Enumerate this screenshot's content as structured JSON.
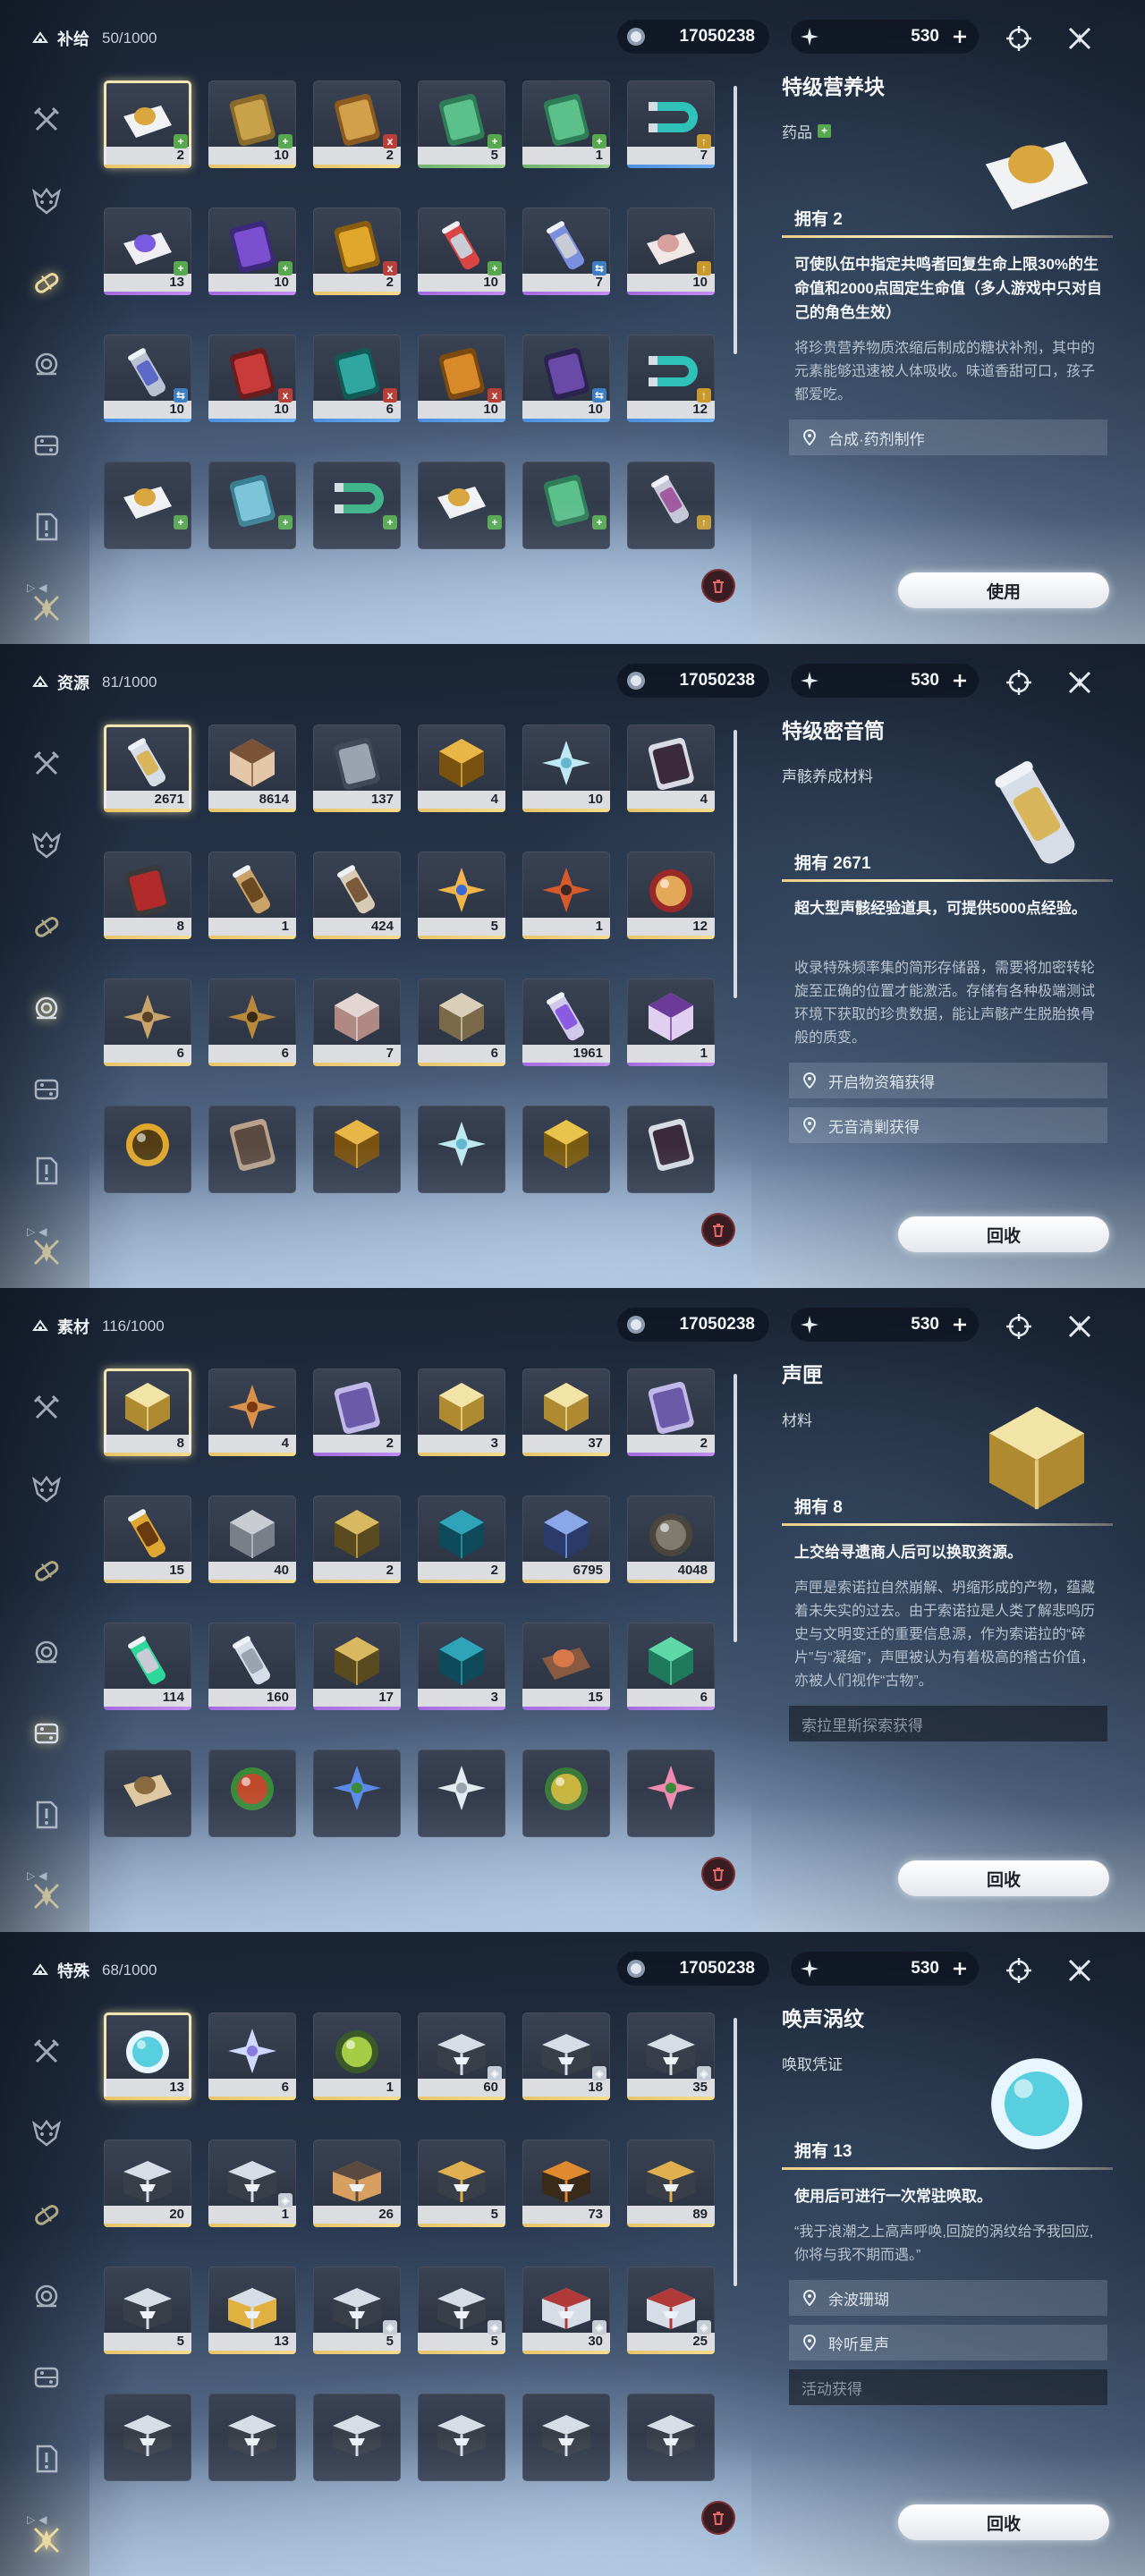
{
  "currency": {
    "coins": "17050238",
    "stamina": "530"
  },
  "panels": [
    {
      "category": "补给",
      "count": "50/1000",
      "active_sidebar": 2,
      "detail": {
        "name": "特级营养块",
        "type": "药品",
        "type_badge": "+",
        "owned": "拥有 2",
        "main": "可使队伍中指定共鸣者回复生命上限30%的生命值和2000点固定生命值（多人游戏中只对自己的角色生效）",
        "desc": "将珍贵营养物质浓缩后制成的糖状补剂，其中的元素能够迅速被人体吸收。味道香甜可口，孩子都爱吃。",
        "sources": [
          "合成·药剂制作"
        ],
        "button": "使用"
      },
      "items": [
        {
          "qty": "2",
          "rarity": "g5",
          "badge": "plus",
          "badge_text": "+",
          "art": "pouch-white"
        },
        {
          "qty": "10",
          "rarity": "g5",
          "badge": "plus",
          "badge_text": "+",
          "art": "bag-gold"
        },
        {
          "qty": "2",
          "rarity": "g5",
          "badge": "x",
          "badge_text": "x",
          "art": "crackers"
        },
        {
          "qty": "5",
          "rarity": "g2",
          "badge": "plus",
          "badge_text": "+",
          "art": "bag-green"
        },
        {
          "qty": "1",
          "rarity": "g2",
          "badge": "plus",
          "badge_text": "+",
          "art": "bag-green"
        },
        {
          "qty": "7",
          "rarity": "g3",
          "badge": "up",
          "badge_text": "↑",
          "art": "magnet"
        },
        {
          "qty": "13",
          "rarity": "g4",
          "badge": "plus",
          "badge_text": "+",
          "art": "pouch-purple"
        },
        {
          "qty": "10",
          "rarity": "g4",
          "badge": "plus",
          "badge_text": "+",
          "art": "bag-purple"
        },
        {
          "qty": "2",
          "rarity": "g5",
          "badge": "x",
          "badge_text": "x",
          "art": "pipe-gold"
        },
        {
          "qty": "10",
          "rarity": "g4",
          "badge": "plus",
          "badge_text": "+",
          "art": "vial-red"
        },
        {
          "qty": "7",
          "rarity": "g4",
          "badge": "swap",
          "badge_text": "⇆",
          "art": "vial-blue"
        },
        {
          "qty": "10",
          "rarity": "g4",
          "badge": "up",
          "badge_text": "↑",
          "art": "teapot"
        },
        {
          "qty": "10",
          "rarity": "g3",
          "badge": "swap",
          "badge_text": "⇆",
          "art": "can-blue"
        },
        {
          "qty": "10",
          "rarity": "g3",
          "badge": "x",
          "badge_text": "x",
          "art": "bag-red"
        },
        {
          "qty": "6",
          "rarity": "g3",
          "badge": "x",
          "badge_text": "x",
          "art": "bag-teal"
        },
        {
          "qty": "10",
          "rarity": "g3",
          "badge": "x",
          "badge_text": "x",
          "art": "bag-orange"
        },
        {
          "qty": "10",
          "rarity": "g3",
          "badge": "swap",
          "badge_text": "⇆",
          "art": "bag-purple2"
        },
        {
          "qty": "12",
          "rarity": "g3",
          "badge": "up",
          "badge_text": "↑",
          "art": "magnet"
        },
        {
          "qty": "",
          "rarity": "",
          "badge": "plus",
          "badge_text": "+",
          "art": "pouch-white"
        },
        {
          "qty": "",
          "rarity": "",
          "badge": "plus",
          "badge_text": "+",
          "art": "bag-teal2"
        },
        {
          "qty": "",
          "rarity": "",
          "badge": "plus",
          "badge_text": "+",
          "art": "magnet-green"
        },
        {
          "qty": "",
          "rarity": "",
          "badge": "plus",
          "badge_text": "+",
          "art": "pouch-white"
        },
        {
          "qty": "",
          "rarity": "",
          "badge": "plus",
          "badge_text": "+",
          "art": "bag-green"
        },
        {
          "qty": "",
          "rarity": "",
          "badge": "up",
          "badge_text": "↑",
          "art": "potion"
        }
      ]
    },
    {
      "category": "资源",
      "count": "81/1000",
      "active_sidebar": 3,
      "detail": {
        "name": "特级密音筒",
        "type": "声骸养成材料",
        "type_badge": "",
        "owned": "拥有 2671",
        "main": "超大型声骸经验道具，可提供5000点经验。",
        "desc": "收录特殊频率集的简形存储器，需要将加密转轮旋至正确的位置才能激活。存储有各种极端测试环境下获取的珍贵数据，能让声骸产生脱胎换骨般的质变。",
        "sources": [
          "开启物资箱获得",
          "无音清剿获得"
        ],
        "button": "回收"
      },
      "items": [
        {
          "qty": "2671",
          "rarity": "g5",
          "badge": "",
          "badge_text": "",
          "art": "cylinder"
        },
        {
          "qty": "8614",
          "rarity": "g5",
          "badge": "",
          "badge_text": "",
          "art": "d20"
        },
        {
          "qty": "137",
          "rarity": "g5",
          "badge": "",
          "badge_text": "",
          "art": "device"
        },
        {
          "qty": "4",
          "rarity": "g5",
          "badge": "",
          "badge_text": "",
          "art": "gold-hex"
        },
        {
          "qty": "10",
          "rarity": "g5",
          "badge": "",
          "badge_text": "",
          "art": "crystal-flower"
        },
        {
          "qty": "4",
          "rarity": "g5",
          "badge": "",
          "badge_text": "",
          "art": "mask"
        },
        {
          "qty": "8",
          "rarity": "g5",
          "badge": "",
          "badge_text": "",
          "art": "red-mech"
        },
        {
          "qty": "1",
          "rarity": "g5",
          "badge": "",
          "badge_text": "",
          "art": "scroll"
        },
        {
          "qty": "424",
          "rarity": "g5",
          "badge": "",
          "badge_text": "",
          "art": "bottle"
        },
        {
          "qty": "5",
          "rarity": "g5",
          "badge": "",
          "badge_text": "",
          "art": "flame-blue"
        },
        {
          "qty": "1",
          "rarity": "g5",
          "badge": "",
          "badge_text": "",
          "art": "flame-red"
        },
        {
          "qty": "12",
          "rarity": "g5",
          "badge": "",
          "badge_text": "",
          "art": "orb-red"
        },
        {
          "qty": "6",
          "rarity": "g5",
          "badge": "",
          "badge_text": "",
          "art": "feather"
        },
        {
          "qty": "6",
          "rarity": "g5",
          "badge": "",
          "badge_text": "",
          "art": "claw"
        },
        {
          "qty": "7",
          "rarity": "g5",
          "badge": "",
          "badge_text": "",
          "art": "cubes"
        },
        {
          "qty": "6",
          "rarity": "g5",
          "badge": "",
          "badge_text": "",
          "art": "web"
        },
        {
          "qty": "1961",
          "rarity": "g4",
          "badge": "",
          "badge_text": "",
          "art": "cylinder-purple"
        },
        {
          "qty": "1",
          "rarity": "g4",
          "badge": "",
          "badge_text": "",
          "art": "d20-purple"
        },
        {
          "qty": "",
          "rarity": "",
          "badge": "",
          "badge_text": "",
          "art": "orb-gold"
        },
        {
          "qty": "",
          "rarity": "",
          "badge": "",
          "badge_text": "",
          "art": "ring"
        },
        {
          "qty": "",
          "rarity": "",
          "badge": "",
          "badge_text": "",
          "art": "gold-hex"
        },
        {
          "qty": "",
          "rarity": "",
          "badge": "",
          "badge_text": "",
          "art": "crystal-flower"
        },
        {
          "qty": "",
          "rarity": "",
          "badge": "",
          "badge_text": "",
          "art": "triangle-gold"
        },
        {
          "qty": "",
          "rarity": "",
          "badge": "",
          "badge_text": "",
          "art": "mask"
        }
      ]
    },
    {
      "category": "素材",
      "count": "116/1000",
      "active_sidebar": 4,
      "detail": {
        "name": "声匣",
        "type": "材料",
        "type_badge": "",
        "owned": "拥有 8",
        "main": "上交给寻遗商人后可以换取资源。",
        "desc": "声匣是索诺拉自然崩解、坍缩形成的产物，蕴藏着未失实的过去。由于索诺拉是人类了解悲鸣历史与文明变迁的重要信息源，作为索诺拉的“碎片”与“凝缩”，声匣被认为有着极高的稽古价值，亦被人们视作“古物”。",
        "sources": [],
        "source_dark": "索拉里斯探索获得",
        "button": "回收"
      },
      "items": [
        {
          "qty": "8",
          "rarity": "g5",
          "badge": "",
          "badge_text": "",
          "art": "glow-cube"
        },
        {
          "qty": "4",
          "rarity": "g5",
          "badge": "",
          "badge_text": "",
          "art": "burst"
        },
        {
          "qty": "2",
          "rarity": "g4",
          "badge": "",
          "badge_text": "",
          "art": "card-purple"
        },
        {
          "qty": "3",
          "rarity": "g5",
          "badge": "",
          "badge_text": "",
          "art": "glow-cube"
        },
        {
          "qty": "37",
          "rarity": "g5",
          "badge": "",
          "badge_text": "",
          "art": "glow-cube"
        },
        {
          "qty": "2",
          "rarity": "g4",
          "badge": "",
          "badge_text": "",
          "art": "card-purple"
        },
        {
          "qty": "15",
          "rarity": "g5",
          "badge": "",
          "badge_text": "",
          "art": "jar-gold"
        },
        {
          "qty": "40",
          "rarity": "g5",
          "badge": "",
          "badge_text": "",
          "art": "cube-silver"
        },
        {
          "qty": "2",
          "rarity": "g5",
          "badge": "",
          "badge_text": "",
          "art": "octa-gold"
        },
        {
          "qty": "2",
          "rarity": "g5",
          "badge": "",
          "badge_text": "",
          "art": "crystal-teal"
        },
        {
          "qty": "6795",
          "rarity": "g5",
          "badge": "",
          "badge_text": "",
          "art": "shard-blue"
        },
        {
          "qty": "4048",
          "rarity": "g5",
          "badge": "",
          "badge_text": "",
          "art": "stone"
        },
        {
          "qty": "114",
          "rarity": "g4",
          "badge": "",
          "badge_text": "",
          "art": "can-green"
        },
        {
          "qty": "160",
          "rarity": "g4",
          "badge": "",
          "badge_text": "",
          "art": "tube"
        },
        {
          "qty": "17",
          "rarity": "g4",
          "badge": "",
          "badge_text": "",
          "art": "octa-gold"
        },
        {
          "qty": "3",
          "rarity": "g4",
          "badge": "",
          "badge_text": "",
          "art": "crystal-teal"
        },
        {
          "qty": "15",
          "rarity": "g4",
          "badge": "",
          "badge_text": "",
          "art": "bowl"
        },
        {
          "qty": "6",
          "rarity": "g4",
          "badge": "",
          "badge_text": "",
          "art": "tri-green"
        },
        {
          "qty": "",
          "rarity": "",
          "badge": "",
          "badge_text": "",
          "art": "beans"
        },
        {
          "qty": "",
          "rarity": "",
          "badge": "",
          "badge_text": "",
          "art": "fruit-red"
        },
        {
          "qty": "",
          "rarity": "",
          "badge": "",
          "badge_text": "",
          "art": "flower-blue"
        },
        {
          "qty": "",
          "rarity": "",
          "badge": "",
          "badge_text": "",
          "art": "stem-white"
        },
        {
          "qty": "",
          "rarity": "",
          "badge": "",
          "badge_text": "",
          "art": "fruit-gold"
        },
        {
          "qty": "",
          "rarity": "",
          "badge": "",
          "badge_text": "",
          "art": "flower-pink"
        }
      ]
    },
    {
      "category": "特殊",
      "count": "68/1000",
      "active_sidebar": 6,
      "detail": {
        "name": "唤声涡纹",
        "type": "唤取凭证",
        "type_badge": "",
        "owned": "拥有 13",
        "main": "使用后可进行一次常驻唤取。",
        "desc": "“我于浪潮之上高声呼唤,回旋的涡纹给予我回应,你将与我不期而遇。”",
        "sources": [
          "余波珊瑚",
          "聆听星声"
        ],
        "source_dark": "活动获得",
        "button": "回收"
      },
      "items": [
        {
          "qty": "13",
          "rarity": "g5",
          "badge": "",
          "badge_text": "",
          "art": "swirl"
        },
        {
          "qty": "6",
          "rarity": "g5",
          "badge": "",
          "badge_text": "",
          "art": "coral"
        },
        {
          "qty": "1",
          "rarity": "g5",
          "badge": "",
          "badge_text": "",
          "art": "orb-green"
        },
        {
          "qty": "60",
          "rarity": "g5",
          "badge": "sp",
          "badge_text": "◈",
          "art": "chest"
        },
        {
          "qty": "18",
          "rarity": "g5",
          "badge": "sp",
          "badge_text": "◈",
          "art": "chest"
        },
        {
          "qty": "35",
          "rarity": "g5",
          "badge": "sp",
          "badge_text": "◈",
          "art": "chest"
        },
        {
          "qty": "20",
          "rarity": "g5",
          "badge": "",
          "badge_text": "",
          "art": "chest"
        },
        {
          "qty": "1",
          "rarity": "g5",
          "badge": "sp",
          "badge_text": "◈",
          "art": "chest"
        },
        {
          "qty": "26",
          "rarity": "g5",
          "badge": "",
          "badge_text": "",
          "art": "chest-dark"
        },
        {
          "qty": "5",
          "rarity": "g5",
          "badge": "",
          "badge_text": "",
          "art": "chest-gold"
        },
        {
          "qty": "73",
          "rarity": "g5",
          "badge": "",
          "badge_text": "",
          "art": "chest-orange"
        },
        {
          "qty": "89",
          "rarity": "g5",
          "badge": "",
          "badge_text": "",
          "art": "chest-gold"
        },
        {
          "qty": "5",
          "rarity": "g5",
          "badge": "",
          "badge_text": "",
          "art": "chest"
        },
        {
          "qty": "13",
          "rarity": "g5",
          "badge": "",
          "badge_text": "",
          "art": "chest-open"
        },
        {
          "qty": "5",
          "rarity": "g5",
          "badge": "sp",
          "badge_text": "◈",
          "art": "chest"
        },
        {
          "qty": "5",
          "rarity": "g5",
          "badge": "sp",
          "badge_text": "◈",
          "art": "chest"
        },
        {
          "qty": "30",
          "rarity": "g5",
          "badge": "sp",
          "badge_text": "◈",
          "art": "chest-red"
        },
        {
          "qty": "25",
          "rarity": "g5",
          "badge": "sp",
          "badge_text": "◈",
          "art": "chest-red"
        },
        {
          "qty": "",
          "rarity": "",
          "badge": "",
          "badge_text": "",
          "art": "chest"
        },
        {
          "qty": "",
          "rarity": "",
          "badge": "",
          "badge_text": "",
          "art": "chest"
        },
        {
          "qty": "",
          "rarity": "",
          "badge": "",
          "badge_text": "",
          "art": "chest"
        },
        {
          "qty": "",
          "rarity": "",
          "badge": "",
          "badge_text": "",
          "art": "chest"
        },
        {
          "qty": "",
          "rarity": "",
          "badge": "",
          "badge_text": "",
          "art": "chest"
        },
        {
          "qty": "",
          "rarity": "",
          "badge": "",
          "badge_text": "",
          "art": "chest"
        }
      ]
    }
  ]
}
